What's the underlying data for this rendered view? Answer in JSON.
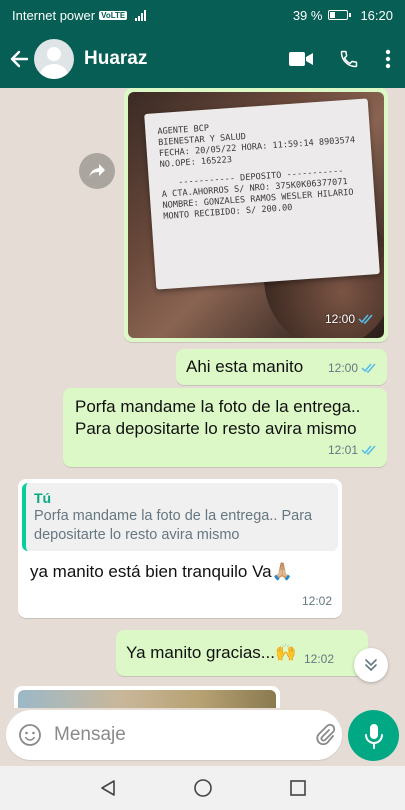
{
  "status_bar": {
    "carrier": "Internet power",
    "network_badge": "VoLTE",
    "battery": "39 %",
    "time": "16:20"
  },
  "header": {
    "contact_name": "Huaraz",
    "icons": [
      "back-arrow-icon",
      "avatar",
      "video-call-icon",
      "phone-icon",
      "more-options-icon"
    ]
  },
  "messages": [
    {
      "type": "image",
      "direction": "outgoing",
      "time": "12:00",
      "status": "read",
      "receipt_lines": [
        "AGENTE BCP",
        "BIENESTAR Y SALUD",
        "FECHA: 20/05/22 HORA: 11:59:14 8903574",
        "NO.OPE: 165223",
        "----------- DEPOSITO -----------",
        "A  CTA.AHORROS   S/  NRO: 375K0K06377071",
        "NOMBRE: GONZALES RAMOS WESLER HILARIO",
        "MONTO RECIBIDO:        S/       200.00"
      ]
    },
    {
      "type": "text",
      "direction": "outgoing",
      "text": "Ahi esta manito",
      "time": "12:00",
      "status": "read"
    },
    {
      "type": "text",
      "direction": "outgoing",
      "text": "Porfa mandame la foto de la entrega.. Para depositarte lo resto avira mismo",
      "time": "12:01",
      "status": "read"
    },
    {
      "type": "reply",
      "direction": "incoming",
      "quote_author": "Tú",
      "quote_text": "Porfa mandame la foto de la entrega.. Para depositarte lo resto avira mismo",
      "text": "ya manito está bien tranquilo Va🙏🏼",
      "time": "12:02"
    },
    {
      "type": "text",
      "direction": "outgoing",
      "text": "Ya manito gracias...🙌",
      "time": "12:02",
      "status": "read"
    }
  ],
  "composer": {
    "placeholder": "Mensaje"
  },
  "colors": {
    "header": "#075e54",
    "outgoing_bubble": "#dcf8c6",
    "incoming_bubble": "#ffffff",
    "chat_bg": "#e5ddd5",
    "read_ticks": "#53bdeb",
    "mic_button": "#00a884"
  }
}
